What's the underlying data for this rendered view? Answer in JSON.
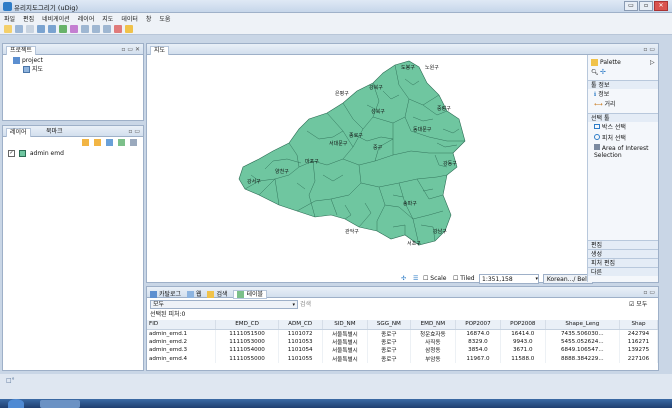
{
  "app": {
    "title": "유리지도그리기 (uDig)"
  },
  "window_buttons": [
    "▭",
    "▫",
    "✕"
  ],
  "menu": [
    "파일",
    "편집",
    "네비게이션",
    "레이어",
    "지도",
    "데이터",
    "창",
    "도움"
  ],
  "project_panel": {
    "tab": "프로젝트",
    "project": "project",
    "map": "지도"
  },
  "layers_panel": {
    "tab1": "레이어",
    "tab2": "북마크",
    "layer": "admin emd"
  },
  "map_panel": {
    "tab": "지도",
    "scale_label": "Scale",
    "tiled_label": "Tiled",
    "scale_value": "1:351,158",
    "crs": "Korean.../ Belt",
    "district_labels": [
      "은평구",
      "강북구",
      "도봉구",
      "노원구",
      "성북구",
      "종로구",
      "중랑구",
      "서대문구",
      "동대문구",
      "마포구",
      "중구",
      "강서구",
      "양천구",
      "관악구",
      "서초구",
      "강남구",
      "송파구",
      "강동구"
    ]
  },
  "palette": {
    "title": "Palette",
    "sections": {
      "tools": "툴 정보",
      "select": "선택 툴",
      "edit": "편집",
      "create": "생성",
      "feature_edit": "피처 편집",
      "other": "다른"
    },
    "tool_items": [
      "정보",
      "거리"
    ],
    "select_items": [
      "박스 선택",
      "피처 선택",
      "Area of Interest Selection"
    ]
  },
  "bottom_panel": {
    "tabs": [
      "카탈로그",
      "웹",
      "검색",
      "테이블"
    ],
    "filter_value": "모두",
    "search_placeholder": "검색",
    "all_check": "모두",
    "selected_count": "선택된 피처:0",
    "columns": [
      "FID",
      "EMD_CD",
      "ADM_CD",
      "SID_NM",
      "SGG_NM",
      "EMD_NM",
      "POP2007",
      "POP2008",
      "Shape_Leng",
      "Shap"
    ],
    "rows": [
      [
        "admin_emd.1",
        "1111051500",
        "1101072",
        "서울특별시",
        "종로구",
        "청운효자동",
        "16874.0",
        "16414.0",
        "7435.506030...",
        "242794"
      ],
      [
        "admin_emd.2",
        "1111053000",
        "1101053",
        "서울특별시",
        "종로구",
        "사직동",
        "8329.0",
        "9943.0",
        "5455.052624...",
        "116271"
      ],
      [
        "admin_emd.3",
        "1111054000",
        "1101054",
        "서울특별시",
        "종로구",
        "삼청동",
        "3854.0",
        "3671.0",
        "6849.106547...",
        "139275"
      ],
      [
        "admin_emd.4",
        "1111055000",
        "1101055",
        "서울특별시",
        "종로구",
        "부암동",
        "11967.0",
        "11588.0",
        "8888.384229...",
        "227106"
      ]
    ]
  },
  "colors": {
    "district_fill": "#6fc6a0",
    "district_stroke": "#2b6b53",
    "accent": "#2e7cc7"
  }
}
